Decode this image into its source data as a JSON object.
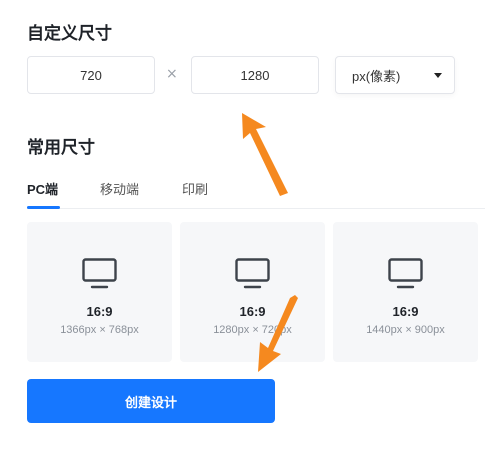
{
  "custom_size": {
    "title": "自定义尺寸",
    "width_value": "720",
    "height_value": "1280",
    "separator": "×",
    "unit": "px(像素)"
  },
  "common_size": {
    "title": "常用尺寸",
    "tabs": [
      {
        "label": "PC端",
        "active": true
      },
      {
        "label": "移动端",
        "active": false
      },
      {
        "label": "印刷",
        "active": false
      }
    ],
    "cards": [
      {
        "icon": "monitor-icon",
        "ratio": "16:9",
        "dims": "1366px × 768px"
      },
      {
        "icon": "monitor-icon",
        "ratio": "16:9",
        "dims": "1280px × 720px"
      },
      {
        "icon": "monitor-icon",
        "ratio": "16:9",
        "dims": "1440px × 900px"
      }
    ]
  },
  "create_button": {
    "label": "创建设计"
  },
  "colors": {
    "primary": "#1677ff",
    "annotation_arrow": "#f5891f",
    "card_bg": "#f6f7f9"
  }
}
